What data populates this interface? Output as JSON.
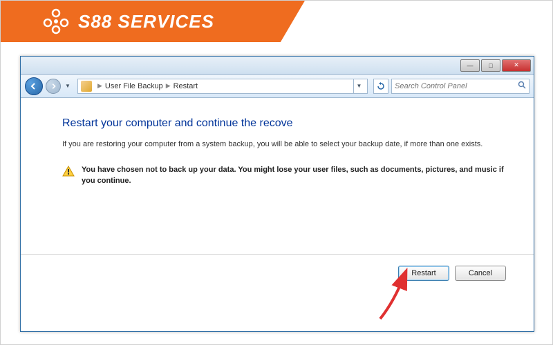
{
  "brand": {
    "name": "S88 SERVICES"
  },
  "titlebar": {
    "minimize": "—",
    "maximize": "□",
    "close": "✕"
  },
  "breadcrumb": {
    "item1": "User File Backup",
    "item2": "Restart"
  },
  "search": {
    "placeholder": "Search Control Panel"
  },
  "main": {
    "heading": "Restart your computer and continue the recove",
    "body": "If you are restoring your computer from a system backup, you will be able to select your backup date, if more than one exists.",
    "warning": "You have chosen not to back up your data. You might lose your user files, such as documents, pictures, and music if you continue."
  },
  "buttons": {
    "restart": "Restart",
    "cancel": "Cancel"
  }
}
